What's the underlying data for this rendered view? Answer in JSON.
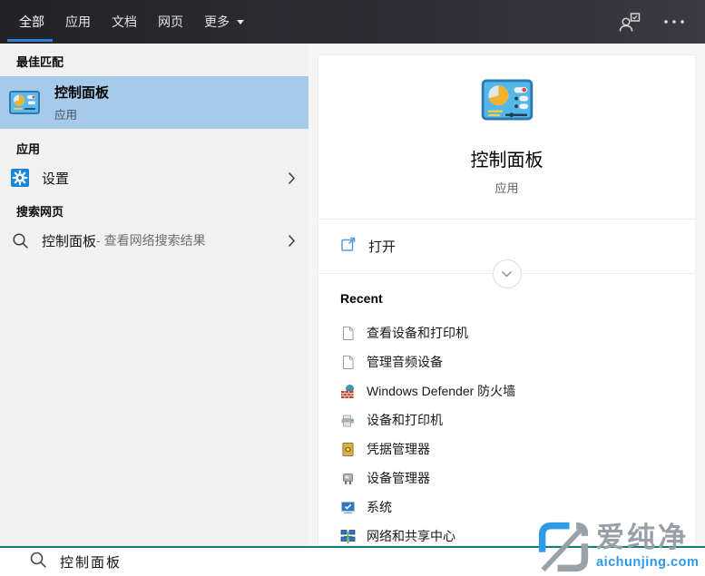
{
  "tabs": {
    "items": [
      "全部",
      "应用",
      "文档",
      "网页",
      "更多"
    ],
    "active_index": 0
  },
  "topbar": {
    "icons": [
      "user-account-icon",
      "more-options-icon"
    ]
  },
  "left_panel": {
    "best_match_header": "最佳匹配",
    "best_match": {
      "title": "控制面板",
      "subtitle": "应用",
      "icon": "control-panel-icon"
    },
    "apps_header": "应用",
    "settings": {
      "label": "设置",
      "icon": "settings-gear-icon"
    },
    "web_header": "搜索网页",
    "web_result": {
      "query": "控制面板",
      "suffix": " - 查看网络搜索结果",
      "icon": "search-icon"
    }
  },
  "preview_panel": {
    "icon": "control-panel-icon",
    "title": "控制面板",
    "subtitle": "应用",
    "open_label": "打开",
    "open_icon": "open-external-icon",
    "recent_header": "Recent",
    "recent_items": [
      {
        "label": "查看设备和打印机",
        "icon": "file-icon"
      },
      {
        "label": "管理音频设备",
        "icon": "file-icon"
      },
      {
        "label": "Windows Defender 防火墙",
        "icon": "firewall-icon"
      },
      {
        "label": "设备和打印机",
        "icon": "devices-printers-icon"
      },
      {
        "label": "凭据管理器",
        "icon": "credential-manager-icon"
      },
      {
        "label": "设备管理器",
        "icon": "device-manager-icon"
      },
      {
        "label": "系统",
        "icon": "system-icon"
      },
      {
        "label": "网络和共享中心",
        "icon": "network-sharing-icon"
      }
    ]
  },
  "search_box": {
    "query": "控制面板",
    "icon": "search-icon"
  },
  "watermark": {
    "name": "爱纯净",
    "domain": "aichunjing.com"
  },
  "colors": {
    "accent_blue": "#2f7fd6",
    "selection_blue": "#a6cae9",
    "topbar_dark": "#28282d",
    "teal_border": "#137c7c",
    "settings_icon_blue": "#1a86d9",
    "watermark_blue": "#2f9be8"
  }
}
